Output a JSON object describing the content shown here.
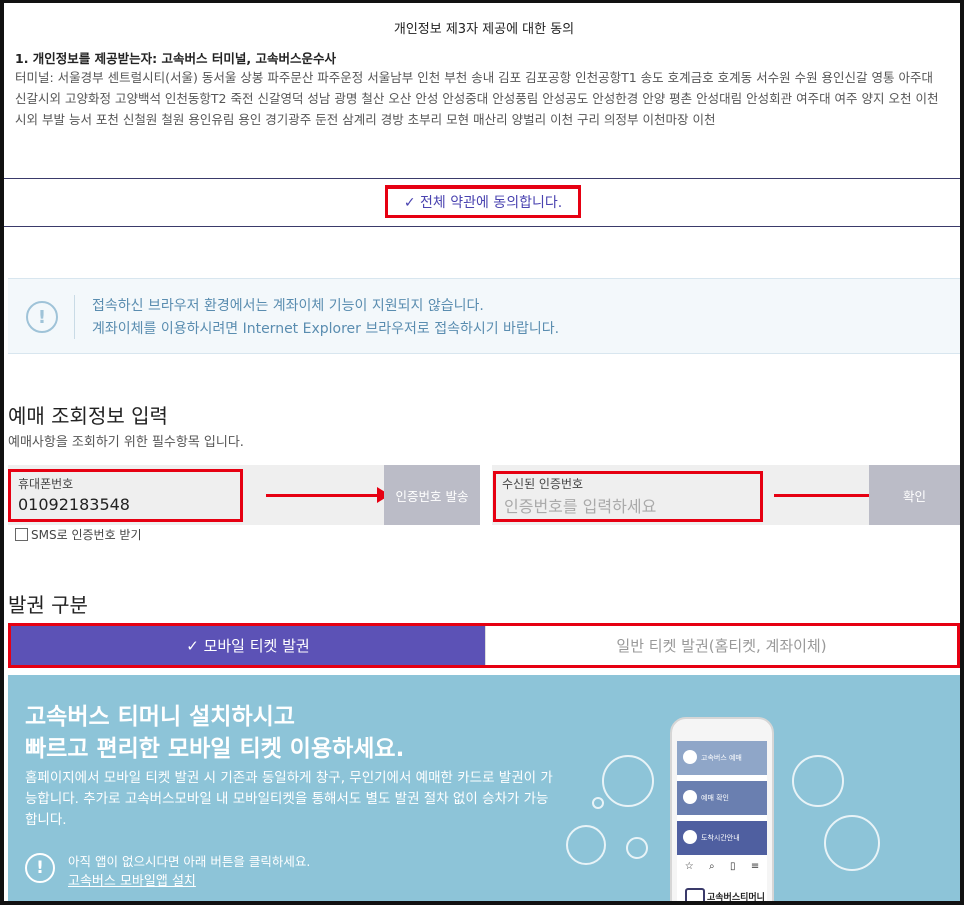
{
  "consent": {
    "title": "개인정보 제3자 제공에 대한 동의",
    "subtitle": "1. 개인정보를 제공받는자: 고속버스 터미널, 고속버스운수사",
    "body": "터미널: 서울경부 센트럴시티(서울) 동서울 상봉 파주문산 파주운정 서울남부 인천 부천 송내 김포 김포공항 인천공항T1 송도 호계금호 호계동 서수원 수원 용인신갈 영통 아주대 신갈시외 고양화정 고양백석 인천동항T2 죽전 신갈영덕 성남 광명 철산 오산 안성 안성중대 안성풍림 안성공도 안성한경 안양 평촌 안성대림 안성회관 여주대 여주 양지 오천 이천시외 부발 능서 포천 신철원 철원 용인유림 용인 경기광주 둔전 삼계리 경방 초부리 모현 매산리 양벌리 이천 구리 의정부 이천마장 이천"
  },
  "agree_all": "✓ 전체 약관에 동의합니다.",
  "notice": {
    "line1": "접속하신 브라우저 환경에서는 계좌이체 기능이 지원되지 않습니다.",
    "line2": "계좌이체를 이용하시려면 Internet Explorer 브라우저로 접속하시기 바랍니다."
  },
  "lookup": {
    "title": "예매 조회정보 입력",
    "desc": "예매사항을 조회하기 위한 필수항목 입니다.",
    "phone_label": "휴대폰번호",
    "phone_value": "01092183548",
    "send_code_button": "인증번호 발송",
    "code_label": "수신된 인증번호",
    "code_placeholder": "인증번호를 입력하세요",
    "confirm_button": "확인",
    "sms_option": "SMS로 인증번호 받기"
  },
  "issue": {
    "title": "발권 구분",
    "tab_mobile": "✓ 모바일 티켓 발권",
    "tab_general": "일반 티켓 발권(홈티켓, 계좌이체)"
  },
  "promo": {
    "headline1": "고속버스 티머니 설치하시고",
    "headline2": "빠르고 편리한 모바일 티켓 이용하세요.",
    "body": "홈페이지에서 모바일 티켓 발권 시 기존과 동일하게 창구, 무인기에서 예매한 카드로 발권이 가능합니다. 추가로 고속버스모바일 내 모바일티켓을 통해서도 별도 발권 절차 없이 승차가 가능합니다.",
    "note": "아직 앱이 없으시다면 아래 버튼을 클릭하세요.",
    "install_link": "고속버스 모바일앱 설치",
    "phone_menu": [
      "고속버스 예매",
      "예매 확인",
      "도착시간안내"
    ],
    "phone_brand": "고속버스티머니"
  },
  "colors": {
    "accent": "#5c52b6",
    "highlight": "#e60012",
    "promo_bg": "#8dc4d8",
    "button_gray": "#bbbcc7"
  }
}
